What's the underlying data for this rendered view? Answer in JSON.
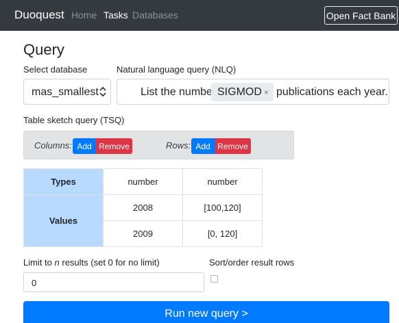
{
  "navbar": {
    "brand": "Duoquest",
    "links": [
      "Home",
      "Tasks",
      "Databases"
    ],
    "active_link": "Tasks",
    "fact_bank_label": "Open Fact Bank"
  },
  "page": {
    "title": "Query"
  },
  "database": {
    "label": "Select database",
    "selected": "mas_smallest"
  },
  "nlq": {
    "label": "Natural language query (NLQ)",
    "text_before": "List the number of",
    "tag": "SIGMOD",
    "tag_remove": "×",
    "text_after": "publications each year."
  },
  "tsq": {
    "label": "Table sketch query (TSQ)",
    "columns_label": "Columns:",
    "rows_label": "Rows:",
    "add_label": "Add",
    "remove_label": "Remove",
    "table": {
      "types_header": "Types",
      "values_header": "Values",
      "types": [
        "number",
        "number"
      ],
      "rows": [
        [
          "2008",
          "[100,120]"
        ],
        [
          "2009",
          "[0, 120]"
        ]
      ]
    }
  },
  "limit": {
    "label_prefix": "Limit to ",
    "label_n": "n",
    "label_suffix": " results (set 0 for no limit)",
    "value": "0"
  },
  "sort": {
    "label": "Sort/order result rows",
    "checked": false
  },
  "run_button": {
    "label": "Run new query >"
  },
  "colors": {
    "navbar": "#343a40",
    "primary": "#007bff",
    "danger": "#dc3545",
    "header_cell": "#b8daff",
    "tsq_box": "#e2e3e5"
  }
}
